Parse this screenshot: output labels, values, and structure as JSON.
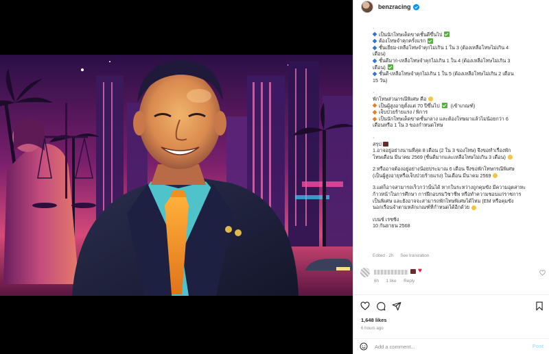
{
  "header": {
    "username": "benzracing",
    "verified_icon": "verified-badge-icon",
    "more_label": "···"
  },
  "caption": {
    "lines": [
      {
        "text": "·",
        "marker": "none",
        "suffix": "none"
      },
      {
        "text": "เป็นนักโทษเด็ดขาดชั้นดีขึ้นไป",
        "marker": "diamond-blue",
        "suffix": "check"
      },
      {
        "text": "ต้องโทษจำคุกครั้งแรก",
        "marker": "diamond-blue",
        "suffix": "check"
      },
      {
        "text": "ชั้นเยี่ยม-เหลือโทษจำคุกไม่เกิน 1 ใน 3 (ต้องเหลือโทษไม่เกิน 4",
        "marker": "diamond-blue",
        "suffix": "none"
      },
      {
        "text": "เดือน)",
        "marker": "none",
        "suffix": "none"
      },
      {
        "text": "ชั้นดีมาก-เหลือโทษจำคุกไม่เกิน 1 ใน 4 (ต้องเหลือโทษไม่เกิน 3",
        "marker": "diamond-blue",
        "suffix": "none"
      },
      {
        "text": "เดือน)",
        "marker": "none",
        "suffix": "check"
      },
      {
        "text": "ชั้นดี-เหลือโทษจำคุกไม่เกิน 1 ใน 5 (ต้องเหลือโทษไม่เกิน 2 เดือน",
        "marker": "diamond-blue",
        "suffix": "none"
      },
      {
        "text": "15 วัน)",
        "marker": "none",
        "suffix": "none"
      },
      {
        "text": "",
        "marker": "gap",
        "suffix": "none"
      },
      {
        "text": "·",
        "marker": "none",
        "suffix": "none"
      },
      {
        "text": "พักโทษส่วนกรณีพิเศษ คือ",
        "marker": "none",
        "suffix": "smile"
      },
      {
        "text": "เป็นผู้สูงอายุตั้งแต่ 70 ปีขึ้นไป",
        "marker": "diamond-orange",
        "suffix": "check-then-text",
        "after": " (เข้าเกณฑ์)"
      },
      {
        "text": "เจ็บป่วยร้ายแรง / พิการ",
        "marker": "diamond-orange",
        "suffix": "none"
      },
      {
        "text": "เป็นนักโทษเด็ดขาดชั้นกลาง และต้องโทษมาแล้วไม่น้อยกว่า 6",
        "marker": "diamond-orange",
        "suffix": "none"
      },
      {
        "text": "เดือนหรือ 1 ใน 3 ของกำหนดโทษ",
        "marker": "none",
        "suffix": "none"
      },
      {
        "text": "",
        "marker": "gap",
        "suffix": "none"
      },
      {
        "text": "·",
        "marker": "none",
        "suffix": "none"
      },
      {
        "text": "สรุป",
        "marker": "none",
        "suffix": "box"
      },
      {
        "text": "1.อาจอยู่อย่างนานที่สุด 8 เดือน (2 ใน 3 ของโทษ) จึงขอทำเรื่องพัก",
        "marker": "none",
        "suffix": "none"
      },
      {
        "text": "โทษเดือน มีนาคม 2569 (ชั้นดีมากและเหลือโทษไม่เกิน 3 เดือน)",
        "marker": "none",
        "suffix": "smile"
      },
      {
        "text": "",
        "marker": "gap",
        "suffix": "none"
      },
      {
        "text": "2.หรืออาจต้องอยู่อย่างน้อยประมาณ 6 เดือน จึงขอพักโทษกรณีพิเศษ",
        "marker": "none",
        "suffix": "none"
      },
      {
        "text": "(เป็นผู้สูงอายุหรือเจ็บป่วยร้ายแรง) ในเดือน มีนาคม 2569",
        "marker": "none",
        "suffix": "smile"
      },
      {
        "text": "",
        "marker": "gap",
        "suffix": "none"
      },
      {
        "text": "3.แต่ก็อาจสามารถเร็วกว่านั้นได้ หากในระหว่างถูกคุมขัง มีความอุตสาหะ",
        "marker": "none",
        "suffix": "none"
      },
      {
        "text": "ก้าวหน้าในการศึกษา การฝึกอบรมวิชาชีพ หรือทำความชอบแก่ราชการ",
        "marker": "none",
        "suffix": "none"
      },
      {
        "text": "เป็นพิเศษ และยังอาจจะสามารถพักโทษพิเศษได้ไหม (EM หรือคุมขัง",
        "marker": "none",
        "suffix": "none"
      },
      {
        "text": "นอกเรือนจำตามหลักเกณฑ์ที่กำหนดได้อีกด้วย",
        "marker": "none",
        "suffix": "smile"
      },
      {
        "text": "",
        "marker": "gap",
        "suffix": "none"
      },
      {
        "text": "เบนซ์ เรซซิ่ง",
        "marker": "none",
        "suffix": "none"
      },
      {
        "text": "10 กันยายน 2568",
        "marker": "none",
        "suffix": "none"
      }
    ]
  },
  "meta": {
    "edited": "Edited · 2h",
    "see_translation": "See translation"
  },
  "comment": {
    "time": "6h",
    "likes": "1 like",
    "reply": "Reply"
  },
  "actions": {
    "like_icon": "heart-outline-icon",
    "comment_icon": "comment-bubble-icon",
    "share_icon": "paper-plane-icon",
    "save_icon": "bookmark-icon"
  },
  "stats": {
    "likes": "1,648 likes",
    "ago": "6 hours ago"
  },
  "add_comment": {
    "placeholder": "Add a comment...",
    "post_label": "Post"
  },
  "colors": {
    "accent": "#0095f6",
    "post_disabled": "#b2dffc",
    "heart": "#ed1c3b",
    "check": "#56b13c"
  }
}
